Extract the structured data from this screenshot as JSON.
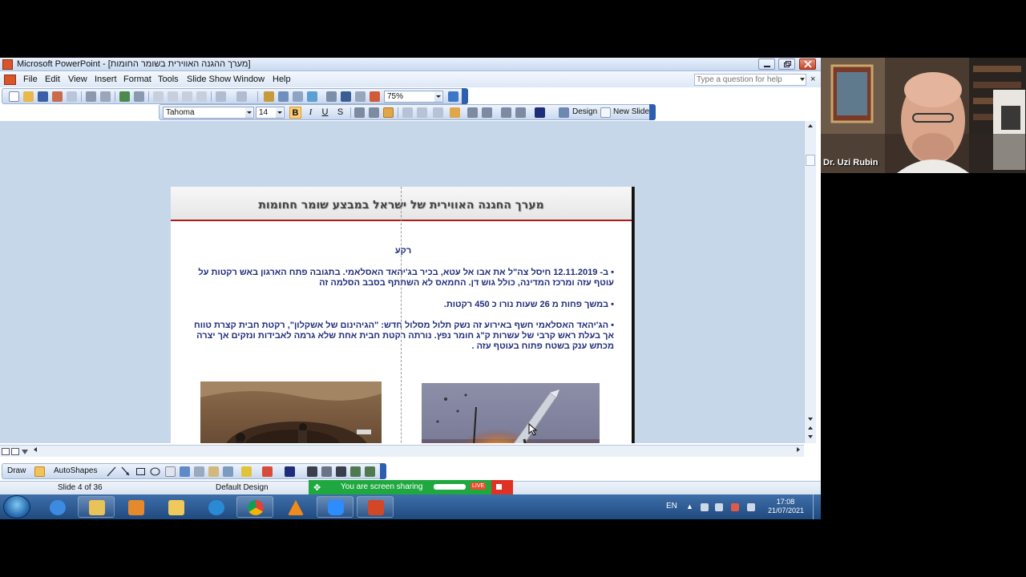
{
  "window": {
    "title": "Microsoft PowerPoint - [מערך ההגנה האווירית בשומר החומות]"
  },
  "menu": {
    "items": [
      "File",
      "Edit",
      "View",
      "Insert",
      "Format",
      "Tools",
      "Slide Show",
      "Window",
      "Help"
    ],
    "help_placeholder": "Type a question for help",
    "close_glyph": "×"
  },
  "toolbar": {
    "zoom": "75%",
    "font_name": "Tahoma",
    "font_size": "14",
    "bold": "B",
    "italic": "I",
    "underline": "U",
    "shadow": "S",
    "design_label": "Design",
    "new_slide_label": "New Slide"
  },
  "slide": {
    "title": "מערך החגנה האווירית של ישראל במבצע שומר חחומות",
    "subtitle": "רקע",
    "bullets": [
      "• ב- 12.11.2019 חיסל צה\"ל את אבו אל עטא, בכיר בג'יהאד האסלאמי. בתגובה פתח הארגון באש רקטות על עוטף עזה ומרכז המדינה, כולל גוש דן. החמאס לא השתתף בסבב הסלמה זה",
      "• במשך פחות מ 26 שעות נורו כ 450 רקטות.",
      "• הג'יהאד האסלאמי חשף באירוע זה נשק תלול מסלול חדש: \"הגיהינום של אשקלון\", רקטת חבית קצרת טווח אך בעלת ראש קרבי של עשרות ק\"ג חומר נפץ. נורתה רקטת חבית אחת שלא גרמה לאבידות ונזקים אך יצרה מכתש ענק בשטח פתוח בעוטף עזה ."
    ]
  },
  "drawing_toolbar": {
    "draw_label": "Draw",
    "autoshapes_label": "AutoShapes"
  },
  "status": {
    "slide_counter": "Slide 4 of 36",
    "design_name": "Default Design",
    "share_text": "You are screen sharing",
    "live_badge": "LIVE"
  },
  "taskbar": {
    "language": "EN",
    "time": "17:08",
    "date": "21/07/2021"
  },
  "video": {
    "participant_name": "Dr. Uzi Rubin"
  },
  "colors": {
    "slide_text": "#1f2c7a",
    "title_rule": "#a81c1c",
    "share_green": "#1fa83f"
  }
}
